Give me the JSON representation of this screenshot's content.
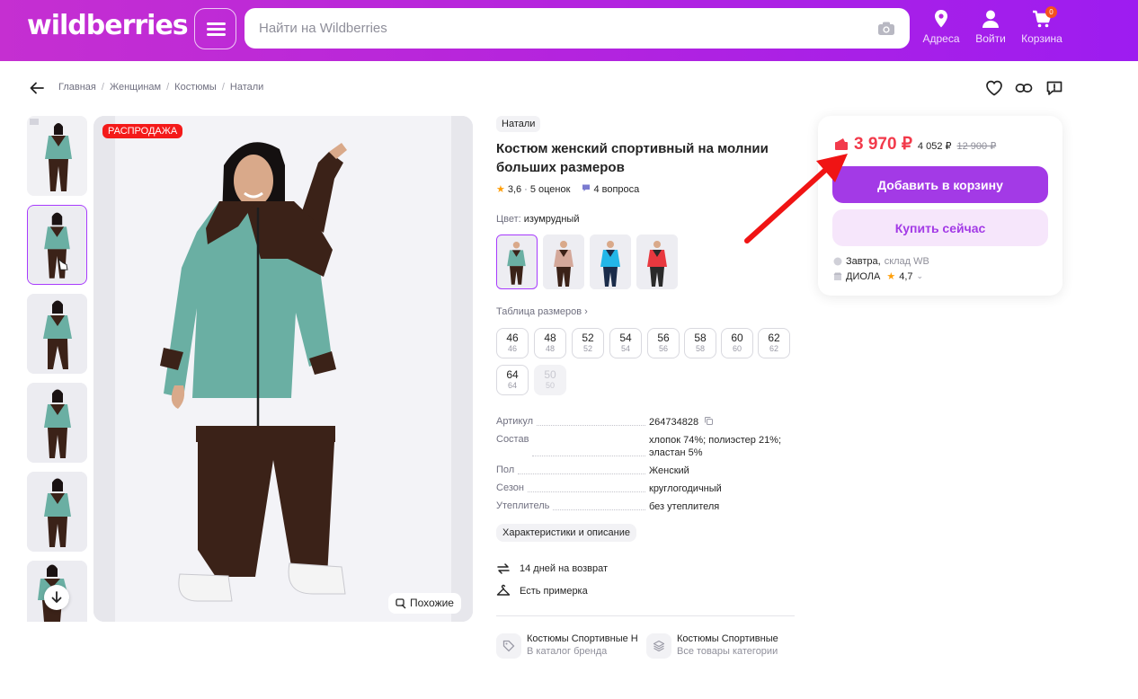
{
  "header": {
    "logo": "wildberries",
    "search_placeholder": "Найти на Wildberries",
    "nav": [
      {
        "label": "Адреса",
        "icon": "location-pin-icon"
      },
      {
        "label": "Войти",
        "icon": "user-icon"
      },
      {
        "label": "Корзина",
        "icon": "cart-icon",
        "badge": "0"
      }
    ]
  },
  "breadcrumbs": [
    "Главная",
    "Женщинам",
    "Костюмы",
    "Натали"
  ],
  "gallery": {
    "sale_badge": "РАСПРОДАЖА",
    "similar_label": "Похожие"
  },
  "product": {
    "brand": "Натали",
    "title": "Костюм женский спортивный на молнии больших размеров",
    "rating": "3,6",
    "reviews": "5 оценок",
    "questions": "4 вопроса",
    "color_label": "Цвет:",
    "color_value": "изумрудный",
    "size_table_label": "Таблица размеров",
    "sizes": [
      {
        "main": "46",
        "sub": "46",
        "available": true
      },
      {
        "main": "48",
        "sub": "48",
        "available": true
      },
      {
        "main": "52",
        "sub": "52",
        "available": true
      },
      {
        "main": "54",
        "sub": "54",
        "available": true
      },
      {
        "main": "56",
        "sub": "56",
        "available": true
      },
      {
        "main": "58",
        "sub": "58",
        "available": true
      },
      {
        "main": "60",
        "sub": "60",
        "available": true
      },
      {
        "main": "62",
        "sub": "62",
        "available": true
      },
      {
        "main": "64",
        "sub": "64",
        "available": true
      },
      {
        "main": "50",
        "sub": "50",
        "available": false
      }
    ],
    "specs": [
      {
        "key": "Артикул",
        "value": "264734828"
      },
      {
        "key": "Состав",
        "value": "хлопок 74%; полиэстер 21%; эластан 5%"
      },
      {
        "key": "Пол",
        "value": "Женский"
      },
      {
        "key": "Сезон",
        "value": "круглогодичный"
      },
      {
        "key": "Утеплитель",
        "value": "без утеплителя"
      }
    ],
    "chars_button": "Характеристики и описание",
    "features": [
      "14 дней на возврат",
      "Есть примерка"
    ],
    "categories": [
      {
        "title": "Костюмы Спортивные Н",
        "subtitle": "В каталог бренда"
      },
      {
        "title": "Костюмы Спортивные",
        "subtitle": "Все товары категории"
      }
    ]
  },
  "price_card": {
    "price": "3 970 ₽",
    "wallet_price": "4 052 ₽",
    "old_price": "12 900 ₽",
    "add_to_cart": "Добавить в корзину",
    "buy_now": "Купить сейчас",
    "delivery_day": "Завтра,",
    "delivery_warehouse": "склад WB",
    "seller_name": "ДИОЛА",
    "seller_rating": "4,7"
  },
  "colors": {
    "accent": "#a33ae6",
    "price": "#f23a4b",
    "sale": "#f41a1a"
  }
}
